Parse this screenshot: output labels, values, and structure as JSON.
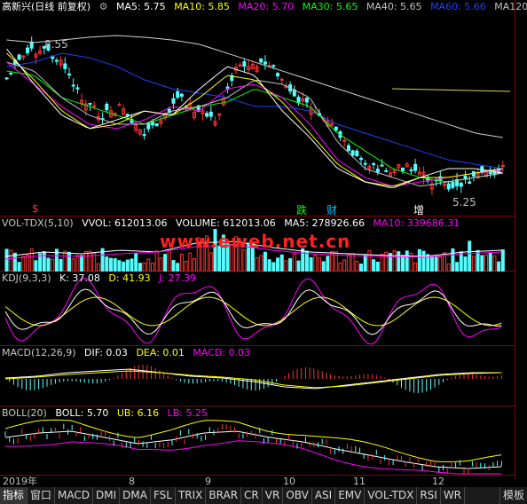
{
  "main": {
    "title": "高新兴(日线 前复权)",
    "settings_icon": "gear-icon",
    "ma": [
      {
        "label": "MA5: 5.75",
        "color": "#ffffff"
      },
      {
        "label": "MA10: 5.85",
        "color": "#ffff00"
      },
      {
        "label": "MA20: 5.70",
        "color": "#ff00ff"
      },
      {
        "label": "MA30: 5.65",
        "color": "#00ff00"
      },
      {
        "label": "MA40: 5.65",
        "color": "#c0c0c0"
      },
      {
        "label": "MA60: 5.66",
        "color": "#2040ff"
      },
      {
        "label": "MA120:",
        "color": "#c0c0c0"
      }
    ],
    "high_label": "8.55",
    "low_label": "5.25",
    "markers": [
      {
        "text": "$",
        "color": "#ff3030"
      },
      {
        "text": "跌",
        "color": "#00ff00"
      },
      {
        "text": "财",
        "color": "#00c0ff"
      },
      {
        "text": "增",
        "color": "#ffffff"
      }
    ]
  },
  "vol": {
    "name": "VOL-TDX(5,10)",
    "vvol": "VVOL: 612013.06",
    "volume": "VOLUME: 612013.06",
    "ma5": "MA5: 278926.66",
    "ma10": "MA10: 339686.31"
  },
  "watermark": "www.eweb.net.cn",
  "kdj": {
    "name": "KDJ(9,3,3)",
    "k": "K: 37.08",
    "d": "D: 41.93",
    "j": "J: 27.39"
  },
  "macd": {
    "name": "MACD(12,26,9)",
    "dif": "DIF: 0.03",
    "dea": "DEA: 0.01",
    "macd": "MACD: 0.03"
  },
  "boll": {
    "name": "BOLL(20)",
    "boll": "BOLL: 5.70",
    "ub": "UB: 6.16",
    "lb": "LB: 5.25"
  },
  "dates": [
    "2019年",
    "8",
    "9",
    "10",
    "11",
    "12"
  ],
  "tabs": [
    "指标",
    "窗口",
    "MACD",
    "DMI",
    "DMA",
    "FSL",
    "TRIX",
    "BRAR",
    "CR",
    "VR",
    "OBV",
    "ASI",
    "EMV",
    "VOL-TDX",
    "RSI",
    "WR"
  ],
  "template_tab": "模板",
  "colors": {
    "up": "#ff3232",
    "down": "#54ffff",
    "grid": "#8b0000"
  }
}
